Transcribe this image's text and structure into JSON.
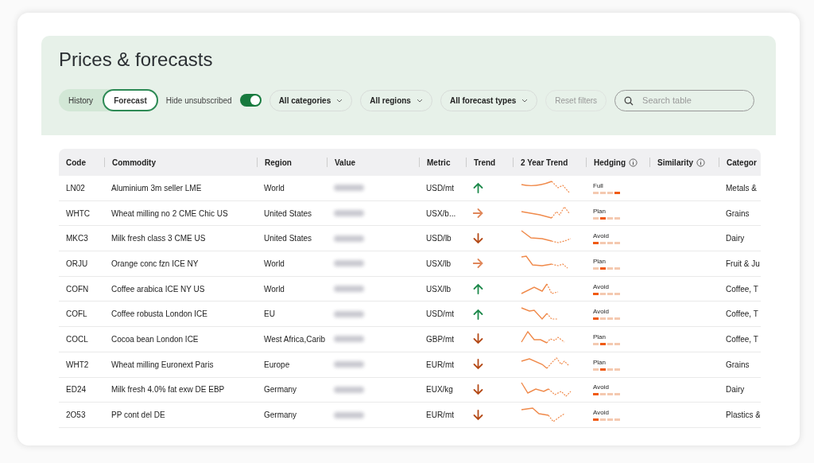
{
  "title": "Prices & forecasts",
  "view_tabs": [
    {
      "label": "History",
      "selected": false
    },
    {
      "label": "Forecast",
      "selected": true
    }
  ],
  "hide_unsubscribed": {
    "label": "Hide unsubscribed",
    "on": true
  },
  "filters": [
    {
      "label": "All categories"
    },
    {
      "label": "All regions"
    },
    {
      "label": "All forecast types"
    }
  ],
  "reset": {
    "label": "Reset filters",
    "disabled": true
  },
  "search": {
    "placeholder": "Search table"
  },
  "table": {
    "columns": [
      {
        "label": "Code",
        "info": false
      },
      {
        "label": "Commodity",
        "info": false
      },
      {
        "label": "Region",
        "info": false
      },
      {
        "label": "Value",
        "info": false
      },
      {
        "label": "Metric",
        "info": false
      },
      {
        "label": "Trend",
        "info": false
      },
      {
        "label": "2 Year Trend",
        "info": false
      },
      {
        "label": "Hedging",
        "info": true
      },
      {
        "label": "Similarity",
        "info": true
      },
      {
        "label": "Categor",
        "info": false
      }
    ],
    "rows": [
      {
        "code": "LN02",
        "commodity": "Aluminium 3m seller LME",
        "region": "World",
        "metric": "USD/mt",
        "kind": "up",
        "hedging": "Full",
        "level": 1,
        "category": "Metals &"
      },
      {
        "code": "WHTC",
        "commodity": "Wheat milling no 2 CME Chic US",
        "region": "United States",
        "metric": "USX/b...",
        "kind": "flat",
        "hedging": "Plan",
        "level": 0.5,
        "category": "Grains"
      },
      {
        "code": "MKC3",
        "commodity": "Milk fresh class 3 CME US",
        "region": "United States",
        "metric": "USD/lb",
        "kind": "down",
        "hedging": "Avoid",
        "level": 0.25,
        "category": "Dairy"
      },
      {
        "code": "ORJU",
        "commodity": "Orange conc fzn ICE NY",
        "region": "World",
        "metric": "USX/lb",
        "kind": "flat",
        "hedging": "Plan",
        "level": 0.5,
        "category": "Fruit & Ju"
      },
      {
        "code": "COFN",
        "commodity": "Coffee arabica ICE NY US",
        "region": "World",
        "metric": "USX/lb",
        "kind": "up",
        "hedging": "Avoid",
        "level": 0.25,
        "category": "Coffee, T"
      },
      {
        "code": "COFL",
        "commodity": "Coffee robusta London ICE",
        "region": "EU",
        "metric": "USD/mt",
        "kind": "up",
        "hedging": "Avoid",
        "level": 0.25,
        "category": "Coffee, T"
      },
      {
        "code": "COCL",
        "commodity": "Cocoa bean London ICE",
        "region": "West Africa,Carib",
        "metric": "GBP/mt",
        "kind": "down",
        "hedging": "Plan",
        "level": 0.5,
        "category": "Coffee, T"
      },
      {
        "code": "WHT2",
        "commodity": "Wheat milling Euronext Paris",
        "region": "Europe",
        "metric": "EUR/mt",
        "kind": "down",
        "hedging": "Plan",
        "level": 0.5,
        "category": "Grains"
      },
      {
        "code": "ED24",
        "commodity": "Milk fresh 4.0% fat exw DE EBP",
        "region": "Germany",
        "metric": "EUX/kg",
        "kind": "down",
        "hedging": "Avoid",
        "level": 0.25,
        "category": "Dairy"
      },
      {
        "code": "2O53",
        "commodity": "PP cont del DE",
        "region": "Germany",
        "metric": "EUR/mt",
        "kind": "down",
        "hedging": "Avoid",
        "level": 0.25,
        "category": "Plastics &"
      }
    ]
  }
}
